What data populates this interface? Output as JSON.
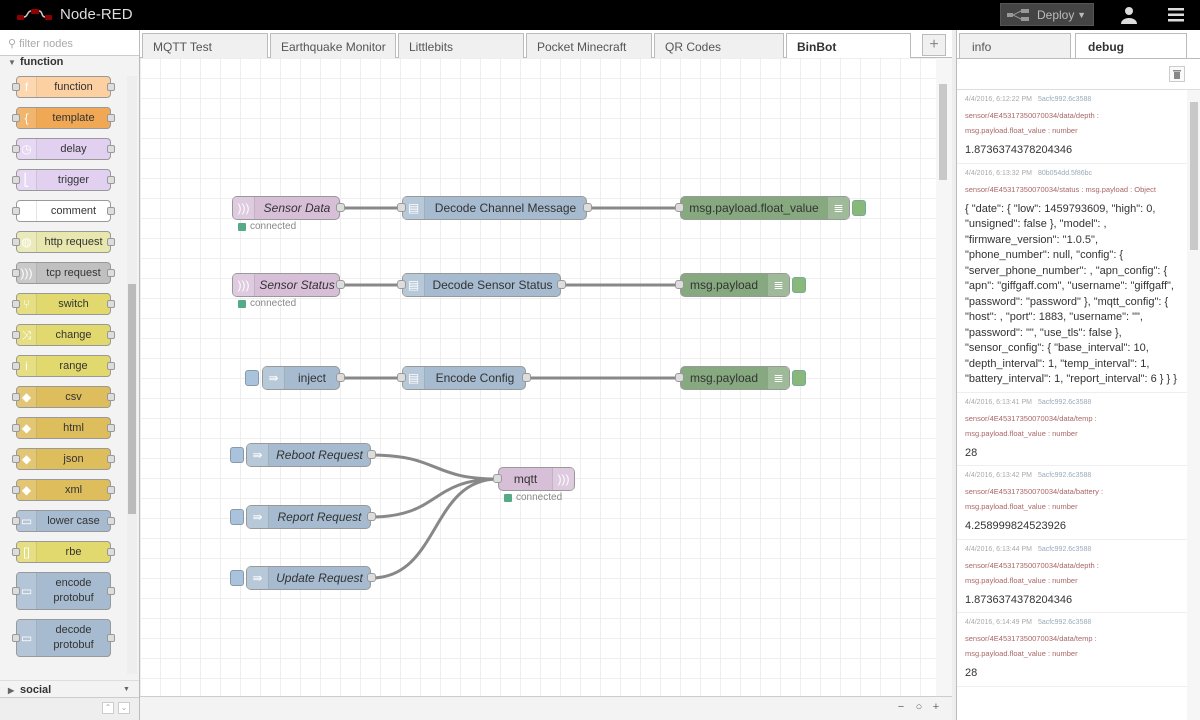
{
  "header": {
    "app_title": "Node-RED",
    "deploy_label": "Deploy",
    "logo_icon": "node-red-logo-icon",
    "user_icon": "user-icon",
    "menu_icon": "hamburger-menu-icon"
  },
  "palette": {
    "filter_placeholder": "filter nodes",
    "category_function": "function",
    "category_social": "social",
    "nodes": [
      {
        "label": "function",
        "color": "#fdd0a2",
        "icon": "f"
      },
      {
        "label": "template",
        "color": "#f0a855",
        "icon": "{"
      },
      {
        "label": "delay",
        "color": "#e2d0f1",
        "icon": "◷"
      },
      {
        "label": "trigger",
        "color": "#e2d0f1",
        "icon": "⎣"
      },
      {
        "label": "comment",
        "color": "#ffffff",
        "icon": "✉"
      },
      {
        "label": "http request",
        "color": "#e7e7ae",
        "icon": "◍"
      },
      {
        "label": "tcp request",
        "color": "#c0c0c0",
        "icon": ")))"
      },
      {
        "label": "switch",
        "color": "#e2d96e",
        "icon": "⑂"
      },
      {
        "label": "change",
        "color": "#e2d96e",
        "icon": "⤨"
      },
      {
        "label": "range",
        "color": "#e2d96e",
        "icon": "i"
      },
      {
        "label": "csv",
        "color": "#debd5c",
        "icon": "◆"
      },
      {
        "label": "html",
        "color": "#debd5c",
        "icon": "◆"
      },
      {
        "label": "json",
        "color": "#debd5c",
        "icon": "◆"
      },
      {
        "label": "xml",
        "color": "#debd5c",
        "icon": "◆"
      },
      {
        "label": "lower case",
        "color": "#a6bbcf",
        "icon": "▭"
      },
      {
        "label": "rbe",
        "color": "#e2d96e",
        "icon": "[]"
      },
      {
        "label": "encode protobuf",
        "color": "#a6bbcf",
        "icon": "▭"
      },
      {
        "label": "decode protobuf",
        "color": "#a6bbcf",
        "icon": "▭"
      }
    ]
  },
  "tabs": [
    {
      "label": "MQTT Test"
    },
    {
      "label": "Earthquake Monitor"
    },
    {
      "label": "Littlebits"
    },
    {
      "label": "Pocket Minecraft"
    },
    {
      "label": "QR Codes"
    },
    {
      "label": "BinBot",
      "active": true
    }
  ],
  "add_tab_label": "+",
  "flow": {
    "nodes": {
      "sensor_data": {
        "label": "Sensor Data",
        "color": "#d8bfd8",
        "status": "connected"
      },
      "sensor_status": {
        "label": "Sensor Status",
        "color": "#d8bfd8",
        "status": "connected"
      },
      "inject": {
        "label": "inject",
        "color": "#a6bbcf"
      },
      "decode_channel": {
        "label": "Decode Channel Message",
        "color": "#a6bbcf"
      },
      "decode_sensor": {
        "label": "Decode Sensor Status",
        "color": "#a6bbcf"
      },
      "encode_config": {
        "label": "Encode Config",
        "color": "#a6bbcf"
      },
      "debug1": {
        "label": "msg.payload.float_value",
        "color": "#87a980"
      },
      "debug2": {
        "label": "msg.payload",
        "color": "#87a980"
      },
      "debug3": {
        "label": "msg.payload",
        "color": "#87a980"
      },
      "reboot": {
        "label": "Reboot Request",
        "color": "#a6bbcf"
      },
      "report": {
        "label": "Report Request",
        "color": "#a6bbcf"
      },
      "update": {
        "label": "Update Request",
        "color": "#a6bbcf"
      },
      "mqtt": {
        "label": "mqtt",
        "color": "#d8bfd8",
        "status": "connected"
      }
    }
  },
  "zoom": {
    "out": "−",
    "reset": "○",
    "in": "+"
  },
  "sidebar": {
    "tabs": [
      {
        "label": "info"
      },
      {
        "label": "debug",
        "active": true
      }
    ],
    "messages": [
      {
        "time": "4/4/2016, 6:12:22 PM",
        "node": "5acfc992.6c3588",
        "topic": "sensor/4E45317350070034/data/depth :",
        "type": "msg.payload.float_value : number",
        "value": "1.8736374378204346"
      },
      {
        "time": "4/4/2016, 6:13:32 PM",
        "node": "80b054dd.5f86bc",
        "topic": "sensor/4E45317350070034/status : msg.payload : Object",
        "type": "",
        "value": "{ \"date\": { \"low\": 1459793609, \"high\": 0, \"unsigned\": false }, \"model\": , \"firmware_version\": \"1.0.5\", \"phone_number\": null, \"config\": { \"server_phone_number\": , \"apn_config\": { \"apn\": \"giffgaff.com\", \"username\": \"giffgaff\", \"password\": \"password\" }, \"mqtt_config\": { \"host\": , \"port\": 1883, \"username\": \"\", \"password\": \"\", \"use_tls\": false }, \"sensor_config\": { \"base_interval\": 10, \"depth_interval\": 1, \"temp_interval\": 1, \"battery_interval\": 1, \"report_interval\": 6 } } }"
      },
      {
        "time": "4/4/2016, 6:13:41 PM",
        "node": "5acfc992.6c3588",
        "topic": "sensor/4E45317350070034/data/temp :",
        "type": "msg.payload.float_value : number",
        "value": "28"
      },
      {
        "time": "4/4/2016, 6:13:42 PM",
        "node": "5acfc992.6c3588",
        "topic": "sensor/4E45317350070034/data/battery :",
        "type": "msg.payload.float_value : number",
        "value": "4.258999824523926"
      },
      {
        "time": "4/4/2016, 6:13:44 PM",
        "node": "5acfc992.6c3588",
        "topic": "sensor/4E45317350070034/data/depth :",
        "type": "msg.payload.float_value : number",
        "value": "1.8736374378204346"
      },
      {
        "time": "4/4/2016, 6:14:49 PM",
        "node": "5acfc992.6c3588",
        "topic": "sensor/4E45317350070034/data/temp :",
        "type": "msg.payload.float_value : number",
        "value": "28"
      }
    ]
  }
}
